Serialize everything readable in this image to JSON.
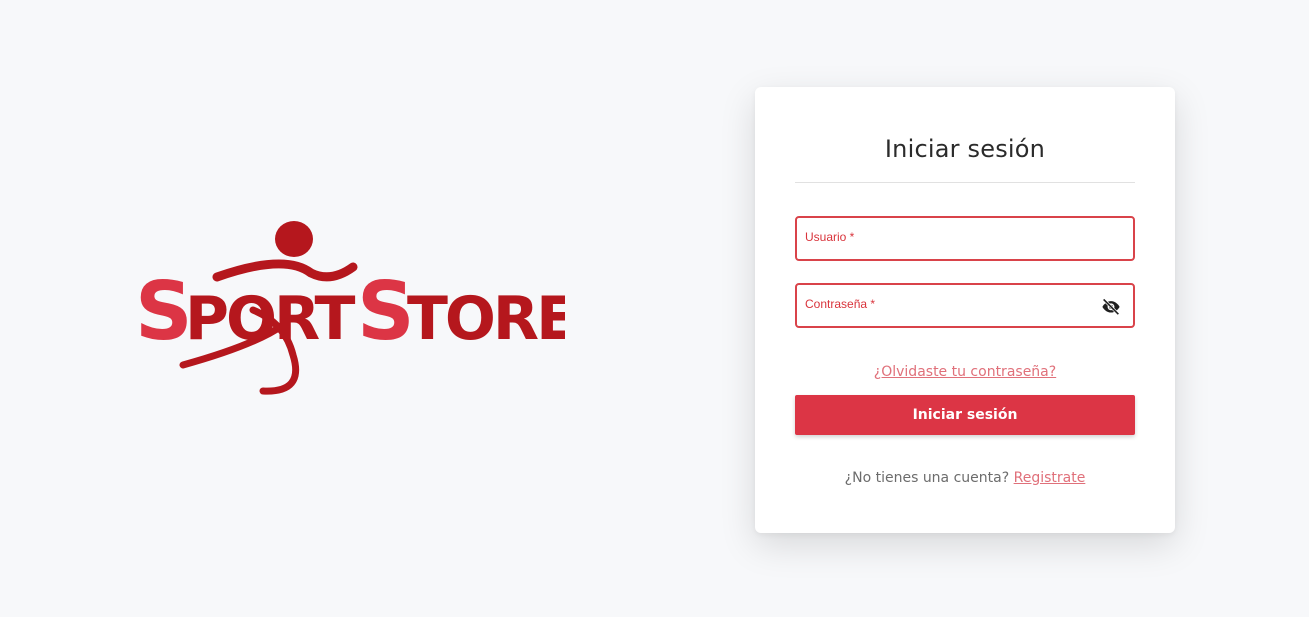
{
  "brand": {
    "logo_text": "SportStore",
    "colors": {
      "dark_red": "#b5171d",
      "light_red": "#dc3545"
    }
  },
  "login": {
    "title": "Iniciar sesión",
    "username_label": "Usuario *",
    "username_value": "",
    "password_label": "Contraseña *",
    "password_value": "",
    "password_toggle_icon": "eye-off-icon",
    "forgot_link": "¿Olvidaste tu contraseña?",
    "submit_label": "Iniciar sesión",
    "signup_prompt": "¿No tienes una cuenta?",
    "signup_link": "Registrate"
  },
  "colors": {
    "background": "#f7f8fa",
    "accent": "#dc3545",
    "field_border": "#d9434a",
    "link": "#e0707a"
  }
}
